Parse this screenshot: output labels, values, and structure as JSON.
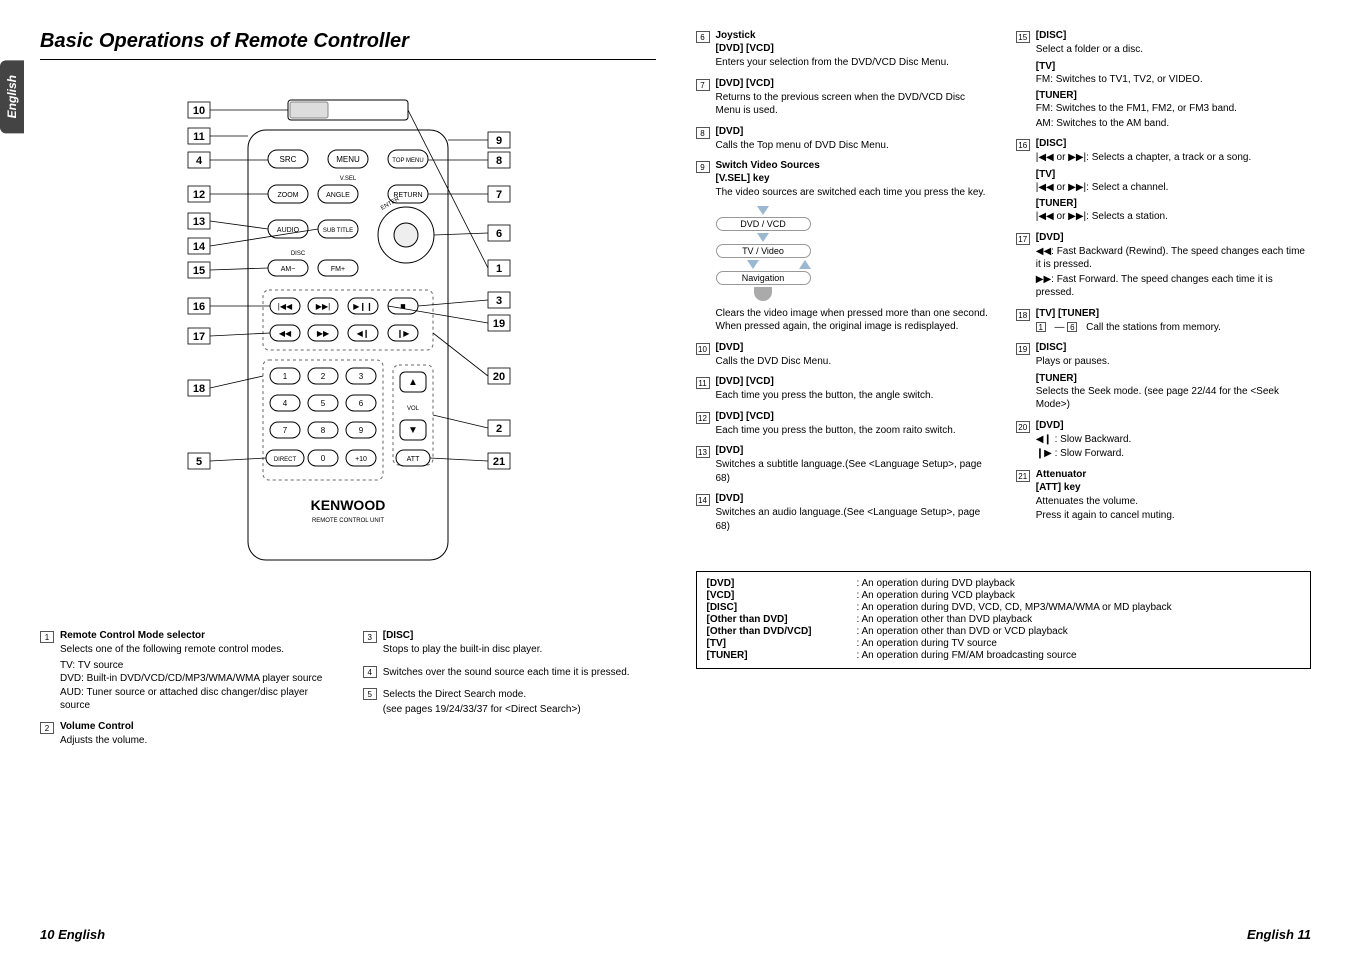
{
  "page": {
    "title": "Basic Operations of Remote Controller",
    "side_tab": "English",
    "page_left": "10 English",
    "page_right": "English 11"
  },
  "remote": {
    "brand": "KENWOOD",
    "subtitle": "REMOTE CONTROL UNIT",
    "buttons": {
      "src": "SRC",
      "menu": "MENU",
      "top_menu": "TOP MENU",
      "zoom": "ZOOM",
      "angle": "ANGLE",
      "return": "RETURN",
      "audio": "AUDIO",
      "sub_title": "SUB TITLE",
      "am_minus": "AM−",
      "fm_plus": "FM+",
      "direct": "DIRECT",
      "att": "ATT",
      "plus10": "+10",
      "vsel": "V.SEL",
      "vol": "VOL",
      "disc": "DISC",
      "enter": "ENTER",
      "num0": "0",
      "num1": "1",
      "num2": "2",
      "num3": "3",
      "num4": "4",
      "num5": "5",
      "num6": "6",
      "num7": "7",
      "num8": "8",
      "num9": "9"
    },
    "callouts": [
      "1",
      "2",
      "3",
      "4",
      "5",
      "6",
      "7",
      "8",
      "9",
      "10",
      "11",
      "12",
      "13",
      "14",
      "15",
      "16",
      "17",
      "18",
      "19",
      "20",
      "21"
    ],
    "slider_positions": [
      "TV",
      "DVD",
      "AUD"
    ]
  },
  "items": {
    "i1": {
      "title": "Remote Control Mode selector",
      "text": "Selects one of the following remote control modes.",
      "lines": [
        "TV: TV source",
        "DVD: Built-in DVD/VCD/CD/MP3/WMA/WMA player source",
        "AUD: Tuner source or attached disc changer/disc player source"
      ]
    },
    "i2": {
      "title": "Volume Control",
      "text": "Adjusts the volume."
    },
    "i3": {
      "title": "[DISC]",
      "text": "Stops to play the built-in disc player."
    },
    "i4": {
      "text": "Switches over the sound source each time it is pressed."
    },
    "i5": {
      "text": "Selects the Direct Search mode.",
      "text2": "(see pages 19/24/33/37 for <Direct Search>)"
    },
    "i6": {
      "title": "Joystick",
      "sub": "[DVD] [VCD]",
      "text": "Enters your selection from the DVD/VCD Disc Menu."
    },
    "i7": {
      "title": "[DVD] [VCD]",
      "text": "Returns to the previous screen when the DVD/VCD Disc Menu is used."
    },
    "i8": {
      "title": "[DVD]",
      "text": "Calls the Top menu of DVD Disc Menu."
    },
    "i9": {
      "title": "Switch Video Sources",
      "sub": "[V.SEL] key",
      "text": "The video sources are switched each time you press the key.",
      "seq": [
        "DVD / VCD",
        "TV / Video",
        "Navigation"
      ],
      "after": "Clears the video image when pressed more than one second. When pressed again, the original image is redisplayed."
    },
    "i10": {
      "title": "[DVD]",
      "text": "Calls the DVD Disc Menu."
    },
    "i11": {
      "title": "[DVD] [VCD]",
      "text": "Each time you press the button, the angle switch."
    },
    "i12": {
      "title": "[DVD] [VCD]",
      "text": "Each time you press the button, the zoom raito switch."
    },
    "i13": {
      "title": "[DVD]",
      "text": "Switches a subtitle language.(See <Language Setup>, page 68)"
    },
    "i14": {
      "title": "[DVD]",
      "text": "Switches an audio language.(See <Language Setup>, page 68)"
    },
    "i15": {
      "disc": {
        "title": "[DISC]",
        "text": "Select a folder or a disc."
      },
      "tv": {
        "title": "[TV]",
        "text": "FM: Switches to TV1, TV2, or VIDEO."
      },
      "tuner": {
        "title": "[TUNER]",
        "l1": "FM: Switches to the FM1, FM2, or FM3 band.",
        "l2": "AM: Switches to the AM band."
      }
    },
    "i16": {
      "disc": {
        "title": "[DISC]",
        "text": "|◀◀ or ▶▶|: Selects a chapter, a track or a song."
      },
      "tv": {
        "title": "[TV]",
        "text": "|◀◀ or ▶▶|: Select a channel."
      },
      "tuner": {
        "title": "[TUNER]",
        "text": "|◀◀ or ▶▶|: Selects a station."
      }
    },
    "i17": {
      "title": "[DVD]",
      "l1": "◀◀: Fast Backward (Rewind). The speed changes each time it is pressed.",
      "l2": "▶▶: Fast Forward. The speed changes each time it is pressed."
    },
    "i18": {
      "title": "[TV] [TUNER]",
      "text_prefix": "1",
      "text_mid": " — ",
      "text_after": "6",
      "text_end": "  Call the stations from memory."
    },
    "i19": {
      "disc": {
        "title": "[DISC]",
        "text": "Plays or pauses."
      },
      "tuner": {
        "title": "[TUNER]",
        "text": "Selects the Seek mode. (see page 22/44 for the <Seek Mode>)"
      }
    },
    "i20": {
      "title": "[DVD]",
      "l1": "◀❙ : Slow Backward.",
      "l2": "❙▶ : Slow Forward."
    },
    "i21": {
      "title": "Attenuator",
      "sub": "[ATT] key",
      "l1": "Attenuates the volume.",
      "l2": "Press it again to cancel muting."
    }
  },
  "footnotes": [
    {
      "k": "[DVD]",
      "v": ": An operation during DVD playback"
    },
    {
      "k": "[VCD]",
      "v": ": An operation during VCD playback"
    },
    {
      "k": "[DISC]",
      "v": ": An operation during DVD, VCD, CD, MP3/WMA/WMA or MD playback"
    },
    {
      "k": "[Other than DVD]",
      "v": ": An operation other than DVD playback"
    },
    {
      "k": "[Other than DVD/VCD]",
      "v": ": An operation other than DVD or VCD playback"
    },
    {
      "k": "[TV]",
      "v": ": An operation during TV source"
    },
    {
      "k": "[TUNER]",
      "v": ": An operation during FM/AM broadcasting source"
    }
  ]
}
